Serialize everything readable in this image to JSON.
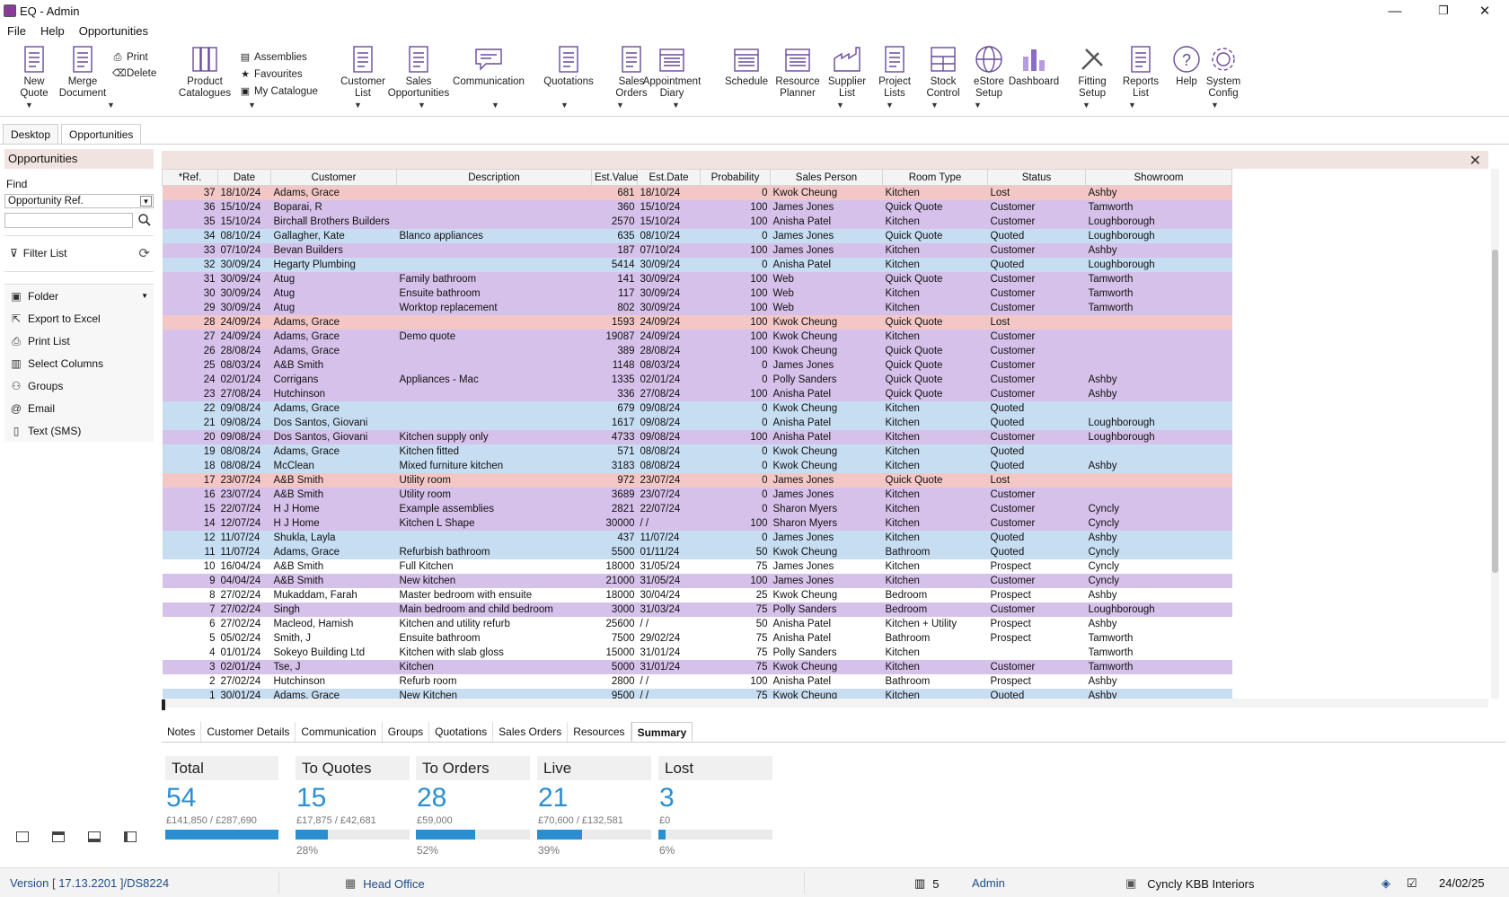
{
  "window": {
    "title": "EQ - Admin",
    "minimize": "—",
    "maximize": "❐",
    "close": "✕"
  },
  "menu": [
    "File",
    "Help",
    "Opportunities"
  ],
  "ribbon": {
    "new_quote": "New\nQuote",
    "merge_document": "Merge\nDocument",
    "print": "Print",
    "delete": "Delete",
    "product_catalogues": "Product\nCatalogues",
    "assemblies": "Assemblies",
    "favourites": "Favourites",
    "my_catalogue": "My Catalogue",
    "customer_list": "Customer\nList",
    "sales_opportunities": "Sales\nOpportunities",
    "communication": "Communication",
    "quotations": "Quotations",
    "sales_orders": "Sales\nOrders",
    "appointment_diary": "Appointment\nDiary",
    "schedule": "Schedule",
    "resource_planner": "Resource\nPlanner",
    "supplier_list": "Supplier\nList",
    "project_lists": "Project\nLists",
    "stock_control": "Stock\nControl",
    "estore_setup": "eStore\nSetup",
    "dashboard": "Dashboard",
    "fitting_setup": "Fitting\nSetup",
    "reports_list": "Reports\nList",
    "help": "Help",
    "system_config": "System\nConfig"
  },
  "tabs": {
    "desktop": "Desktop",
    "opportunities": "Opportunities"
  },
  "sidebar": {
    "title": "Opportunities",
    "find_label": "Find",
    "find_select": "Opportunity Ref.",
    "find_value": "",
    "filter_list": "Filter List",
    "items": [
      "Folder",
      "Export to Excel",
      "Print List",
      "Select Columns",
      "Groups",
      "Email",
      "Text (SMS)"
    ]
  },
  "grid": {
    "columns": [
      "*Ref.",
      "Date",
      "Customer",
      "Description",
      "Est.Value",
      "Est.Date",
      "Probability",
      "Sales Person",
      "Room Type",
      "Status",
      "Showroom"
    ],
    "rows": [
      [
        "37",
        "18/10/24",
        "Adams, Grace",
        "",
        "681",
        "18/10/24",
        "0",
        "Kwok Cheung",
        "Kitchen",
        "Lost",
        "Ashby"
      ],
      [
        "36",
        "15/10/24",
        "Boparai, R",
        "",
        "360",
        "15/10/24",
        "100",
        "James Jones",
        "Quick Quote",
        "Customer",
        "Tamworth"
      ],
      [
        "35",
        "15/10/24",
        "Birchall Brothers Builders",
        "",
        "2570",
        "15/10/24",
        "100",
        "Anisha Patel",
        "Kitchen",
        "Customer",
        "Loughborough"
      ],
      [
        "34",
        "08/10/24",
        "Gallagher, Kate",
        "Blanco appliances",
        "635",
        "08/10/24",
        "0",
        "James Jones",
        "Quick Quote",
        "Quoted",
        "Loughborough"
      ],
      [
        "33",
        "07/10/24",
        "Bevan Builders",
        "",
        "187",
        "07/10/24",
        "100",
        "James Jones",
        "Kitchen",
        "Customer",
        "Ashby"
      ],
      [
        "32",
        "30/09/24",
        "Hegarty Plumbing",
        "",
        "5414",
        "30/09/24",
        "0",
        "Anisha Patel",
        "Kitchen",
        "Quoted",
        "Loughborough"
      ],
      [
        "31",
        "30/09/24",
        "Atug",
        "Family bathroom",
        "141",
        "30/09/24",
        "100",
        "Web",
        "Quick Quote",
        "Customer",
        "Tamworth"
      ],
      [
        "30",
        "30/09/24",
        "Atug",
        "Ensuite bathroom",
        "117",
        "30/09/24",
        "100",
        "Web",
        "Kitchen",
        "Customer",
        "Tamworth"
      ],
      [
        "29",
        "30/09/24",
        "Atug",
        "Worktop replacement",
        "802",
        "30/09/24",
        "100",
        "Web",
        "Kitchen",
        "Customer",
        "Tamworth"
      ],
      [
        "28",
        "24/09/24",
        "Adams, Grace",
        "",
        "1593",
        "24/09/24",
        "100",
        "Kwok Cheung",
        "Quick Quote",
        "Lost",
        ""
      ],
      [
        "27",
        "24/09/24",
        "Adams, Grace",
        "Demo quote",
        "19087",
        "24/09/24",
        "100",
        "Kwok Cheung",
        "Kitchen",
        "Customer",
        ""
      ],
      [
        "26",
        "28/08/24",
        "Adams, Grace",
        "",
        "389",
        "28/08/24",
        "100",
        "Kwok Cheung",
        "Quick Quote",
        "Customer",
        ""
      ],
      [
        "25",
        "08/03/24",
        "A&B Smith",
        "",
        "1148",
        "08/03/24",
        "0",
        "James Jones",
        "Quick Quote",
        "Customer",
        ""
      ],
      [
        "24",
        "02/01/24",
        "Corrigans",
        "Appliances - Mac",
        "1335",
        "02/01/24",
        "0",
        "Polly Sanders",
        "Quick Quote",
        "Customer",
        "Ashby"
      ],
      [
        "23",
        "27/08/24",
        "Hutchinson",
        "",
        "336",
        "27/08/24",
        "100",
        "Anisha Patel",
        "Quick Quote",
        "Customer",
        "Ashby"
      ],
      [
        "22",
        "09/08/24",
        "Adams, Grace",
        "",
        "679",
        "09/08/24",
        "0",
        "Kwok Cheung",
        "Kitchen",
        "Quoted",
        ""
      ],
      [
        "21",
        "09/08/24",
        "Dos Santos, Giovani",
        "",
        "1617",
        "09/08/24",
        "0",
        "Anisha Patel",
        "Kitchen",
        "Quoted",
        "Loughborough"
      ],
      [
        "20",
        "09/08/24",
        "Dos Santos, Giovani",
        "Kitchen supply only",
        "4733",
        "09/08/24",
        "100",
        "Anisha Patel",
        "Kitchen",
        "Customer",
        "Loughborough"
      ],
      [
        "19",
        "08/08/24",
        "Adams, Grace",
        "Kitchen fitted",
        "571",
        "08/08/24",
        "0",
        "Kwok Cheung",
        "Kitchen",
        "Quoted",
        ""
      ],
      [
        "18",
        "08/08/24",
        "McClean",
        "Mixed furniture kitchen",
        "3183",
        "08/08/24",
        "0",
        "Kwok Cheung",
        "Kitchen",
        "Quoted",
        "Ashby"
      ],
      [
        "17",
        "23/07/24",
        "A&B Smith",
        "Utility room",
        "972",
        "23/07/24",
        "0",
        "James Jones",
        "Quick Quote",
        "Lost",
        ""
      ],
      [
        "16",
        "23/07/24",
        "A&B Smith",
        "Utility room",
        "3689",
        "23/07/24",
        "0",
        "James Jones",
        "Kitchen",
        "Customer",
        ""
      ],
      [
        "15",
        "22/07/24",
        "H J Home",
        "Example assemblies",
        "2821",
        "22/07/24",
        "0",
        "Sharon Myers",
        "Kitchen",
        "Customer",
        "Cyncly"
      ],
      [
        "14",
        "12/07/24",
        "H J Home",
        "Kitchen L Shape",
        "30000",
        "/ /",
        "100",
        "Sharon Myers",
        "Kitchen",
        "Customer",
        "Cyncly"
      ],
      [
        "12",
        "11/07/24",
        "Shukla, Layla",
        "",
        "437",
        "11/07/24",
        "0",
        "James Jones",
        "Kitchen",
        "Quoted",
        "Ashby"
      ],
      [
        "11",
        "11/07/24",
        "Adams, Grace",
        "Refurbish bathroom",
        "5500",
        "01/11/24",
        "50",
        "Kwok Cheung",
        "Bathroom",
        "Quoted",
        "Cyncly"
      ],
      [
        "10",
        "16/04/24",
        "A&B Smith",
        "Full Kitchen",
        "18000",
        "31/05/24",
        "75",
        "James Jones",
        "Kitchen",
        "Prospect",
        "Cyncly"
      ],
      [
        "9",
        "04/04/24",
        "A&B Smith",
        "New kitchen",
        "21000",
        "31/05/24",
        "100",
        "James Jones",
        "Kitchen",
        "Customer",
        "Cyncly"
      ],
      [
        "8",
        "27/02/24",
        "Mukaddam, Farah",
        "Master bedroom with ensuite",
        "18000",
        "30/04/24",
        "25",
        "Kwok Cheung",
        "Bedroom",
        "Prospect",
        "Ashby"
      ],
      [
        "7",
        "27/02/24",
        "Singh",
        "Main bedroom and child bedroom",
        "3000",
        "31/03/24",
        "75",
        "Polly Sanders",
        "Bedroom",
        "Customer",
        "Loughborough"
      ],
      [
        "6",
        "27/02/24",
        "Macleod, Hamish",
        "Kitchen and utility refurb",
        "25600",
        "/ /",
        "50",
        "Anisha Patel",
        "Kitchen + Utility",
        "Prospect",
        "Ashby"
      ],
      [
        "5",
        "05/02/24",
        "Smith, J",
        "Ensuite bathroom",
        "7500",
        "29/02/24",
        "75",
        "Anisha Patel",
        "Bathroom",
        "Prospect",
        "Tamworth"
      ],
      [
        "4",
        "01/01/24",
        "Sokeyo Building Ltd",
        "Kitchen with slab gloss",
        "15000",
        "31/01/24",
        "75",
        "Polly Sanders",
        "Kitchen",
        "",
        "Tamworth"
      ],
      [
        "3",
        "02/01/24",
        "Tse, J",
        "Kitchen",
        "5000",
        "31/01/24",
        "75",
        "Kwok Cheung",
        "Kitchen",
        "Customer",
        "Tamworth"
      ],
      [
        "2",
        "27/02/24",
        "Hutchinson",
        "Refurb room",
        "2800",
        "/ /",
        "100",
        "Anisha Patel",
        "Bathroom",
        "Prospect",
        "Ashby"
      ],
      [
        "1",
        "30/01/24",
        "Adams, Grace",
        "New Kitchen",
        "9500",
        "/ /",
        "75",
        "Kwok Cheung",
        "Kitchen",
        "Quoted",
        "Ashby"
      ]
    ],
    "status_colors": {
      "Lost": "#f4c7c7",
      "Customer": "#d6c1ea",
      "Quoted": "#c7ddf2",
      "Prospect": "#ffffff"
    }
  },
  "bottom_tabs": [
    "Notes",
    "Customer Details",
    "Communication",
    "Groups",
    "Quotations",
    "Sales Orders",
    "Resources",
    "Summary"
  ],
  "summary": [
    {
      "title": "Total",
      "count": "54",
      "value": "£141,850 / £287,690",
      "fill": 1.0,
      "pct": ""
    },
    {
      "title": "To Quotes",
      "count": "15",
      "value": "£17,875 / £42,681",
      "fill": 0.28,
      "pct": "28%"
    },
    {
      "title": "To Orders",
      "count": "28",
      "value": "£59,000",
      "fill": 0.52,
      "pct": "52%"
    },
    {
      "title": "Live",
      "count": "21",
      "value": "£70,600 / £132,581",
      "fill": 0.39,
      "pct": "39%"
    },
    {
      "title": "Lost",
      "count": "3",
      "value": "£0",
      "fill": 0.06,
      "pct": "6%"
    }
  ],
  "accent_color": "#2a8fd0",
  "statusbar": {
    "version": "Version [ 17.13.2201 ]/DS8224",
    "branch": "Head Office",
    "count": "5",
    "user": "Admin",
    "company": "Cyncly KBB Interiors",
    "date": "24/02/25"
  }
}
